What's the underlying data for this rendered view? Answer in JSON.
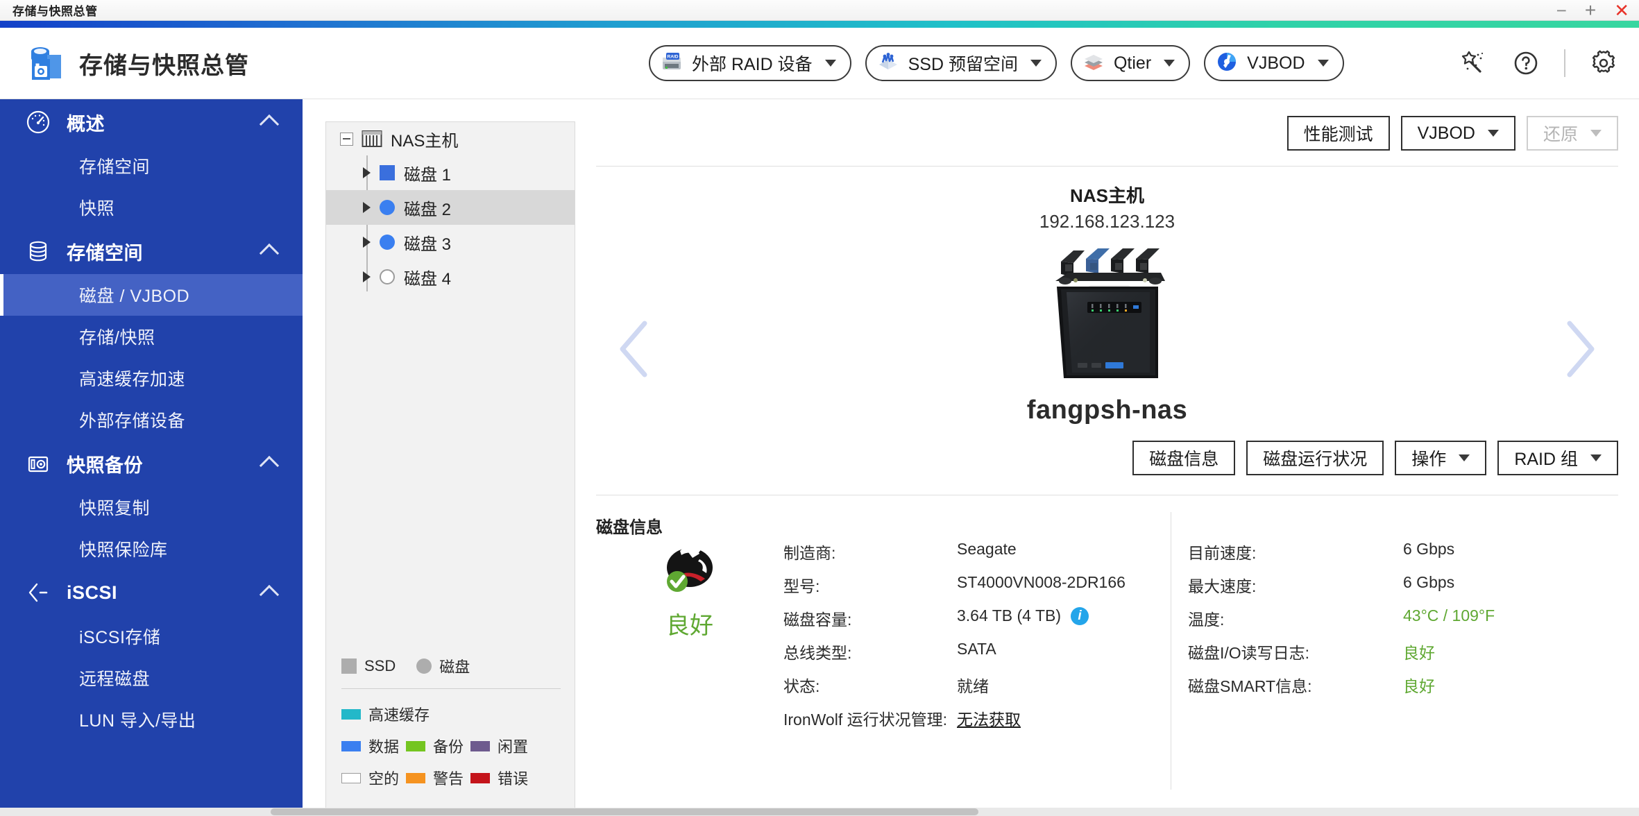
{
  "window": {
    "title": "存储与快照总管",
    "minimize": "−",
    "maximize": "+",
    "close": "✕"
  },
  "header": {
    "app_title": "存储与快照总管",
    "app_icon": "storage-snapshot-manager-icon",
    "tools": [
      {
        "label": "外部 RAID 设备",
        "icon": "external-raid-icon",
        "has_caret": true
      },
      {
        "label": "SSD 预留空间",
        "icon": "ssd-overprovisioning-icon",
        "has_caret": true
      },
      {
        "label": "Qtier",
        "icon": "qtier-icon",
        "has_caret": true
      },
      {
        "label": "VJBOD",
        "icon": "vjbod-icon",
        "has_caret": true
      }
    ],
    "right_icons": [
      {
        "name": "magic-wand-icon"
      },
      {
        "name": "help-circle-icon"
      },
      {
        "name": "gear-icon"
      }
    ]
  },
  "sidebar": {
    "groups": [
      {
        "label": "概述",
        "icon": "gauge-icon",
        "expanded": true,
        "items": [
          {
            "label": "存储空间",
            "active": false
          },
          {
            "label": "快照",
            "active": false
          }
        ]
      },
      {
        "label": "存储空间",
        "icon": "database-icon",
        "expanded": true,
        "items": [
          {
            "label": "磁盘 / VJBOD",
            "active": true
          },
          {
            "label": "存储/快照",
            "active": false
          },
          {
            "label": "高速缓存加速",
            "active": false
          },
          {
            "label": "外部存储设备",
            "active": false
          }
        ]
      },
      {
        "label": "快照备份",
        "icon": "snapshot-camera-icon",
        "expanded": true,
        "items": [
          {
            "label": "快照复制",
            "active": false
          },
          {
            "label": "快照保险库",
            "active": false
          }
        ]
      },
      {
        "label": "iSCSI",
        "icon": "iscsi-icon",
        "expanded": true,
        "items": [
          {
            "label": "iSCSI存储",
            "active": false
          },
          {
            "label": "远程磁盘",
            "active": false
          },
          {
            "label": "LUN 导入/导出",
            "active": false
          }
        ]
      }
    ]
  },
  "tree": {
    "root_label": "NAS主机",
    "root_icon": "nas-rack-icon",
    "items": [
      {
        "label": "磁盘 1",
        "marker": "square-blue",
        "selected": false
      },
      {
        "label": "磁盘 2",
        "marker": "circle-blue",
        "selected": true
      },
      {
        "label": "磁盘 3",
        "marker": "circle-blue",
        "selected": false
      },
      {
        "label": "磁盘 4",
        "marker": "circle-empty",
        "selected": false
      }
    ],
    "legend": {
      "type_row": [
        {
          "label": "SSD",
          "shape": "square",
          "color": "#adadad"
        },
        {
          "label": "磁盘",
          "shape": "circle",
          "color": "#adadad"
        }
      ],
      "usage": [
        [
          {
            "label": "高速缓存",
            "color": "#23b8c9"
          }
        ],
        [
          {
            "label": "数据",
            "color": "#3a7ff0"
          },
          {
            "label": "备份",
            "color": "#74c520"
          },
          {
            "label": "闲置",
            "color": "#6e5b8e"
          }
        ],
        [
          {
            "label": "空的",
            "color": "#ffffff"
          },
          {
            "label": "警告",
            "color": "#f59320"
          },
          {
            "label": "错误",
            "color": "#c4141b"
          }
        ]
      ]
    }
  },
  "content": {
    "top_buttons": [
      {
        "label": "性能测试",
        "caret": false,
        "disabled": false
      },
      {
        "label": "VJBOD",
        "caret": true,
        "disabled": false
      },
      {
        "label": "还原",
        "caret": true,
        "disabled": true
      }
    ],
    "nas": {
      "name": "NAS主机",
      "ip": "192.168.123.123",
      "image_icon": "nas-enclosure-4bay-image",
      "hostname": "fangpsh-nas",
      "prev_icon": "chevron-left-icon",
      "next_icon": "chevron-right-icon"
    },
    "action_buttons": [
      {
        "label": "磁盘信息",
        "caret": false
      },
      {
        "label": "磁盘运行状况",
        "caret": false
      },
      {
        "label": "操作",
        "caret": true
      },
      {
        "label": "RAID 组",
        "caret": true
      }
    ],
    "disk_info": {
      "section_title": "磁盘信息",
      "health_icon": "ironwolf-disk-ok-icon",
      "health_text": "良好",
      "left_fields": [
        {
          "key": "制造商:",
          "value": "Seagate",
          "style": "normal"
        },
        {
          "key": "型号:",
          "value": "ST4000VN008-2DR166",
          "style": "normal"
        },
        {
          "key": "磁盘容量:",
          "value": "3.64 TB (4 TB)",
          "style": "normal",
          "info_icon": "info-icon"
        },
        {
          "key": "总线类型:",
          "value": "SATA",
          "style": "normal"
        },
        {
          "key": "状态:",
          "value": "就绪",
          "style": "normal"
        },
        {
          "key": "IronWolf 运行状况管理:",
          "value": "无法获取",
          "style": "link"
        }
      ],
      "right_fields": [
        {
          "key": "目前速度:",
          "value": "6 Gbps",
          "style": "normal"
        },
        {
          "key": "最大速度:",
          "value": "6 Gbps",
          "style": "normal"
        },
        {
          "key": "温度:",
          "value": "43°C / 109°F",
          "style": "green"
        },
        {
          "key": "磁盘I/O读写日志:",
          "value": "良好",
          "style": "green"
        },
        {
          "key": "磁盘SMART信息:",
          "value": "良好",
          "style": "green"
        }
      ]
    }
  },
  "colors": {
    "sidebar_bg": "#2142ab",
    "sidebar_active": "#4462c4",
    "accent_green": "#5fa832",
    "accent_blue": "#24a5ea",
    "close_red": "#e8332a"
  }
}
